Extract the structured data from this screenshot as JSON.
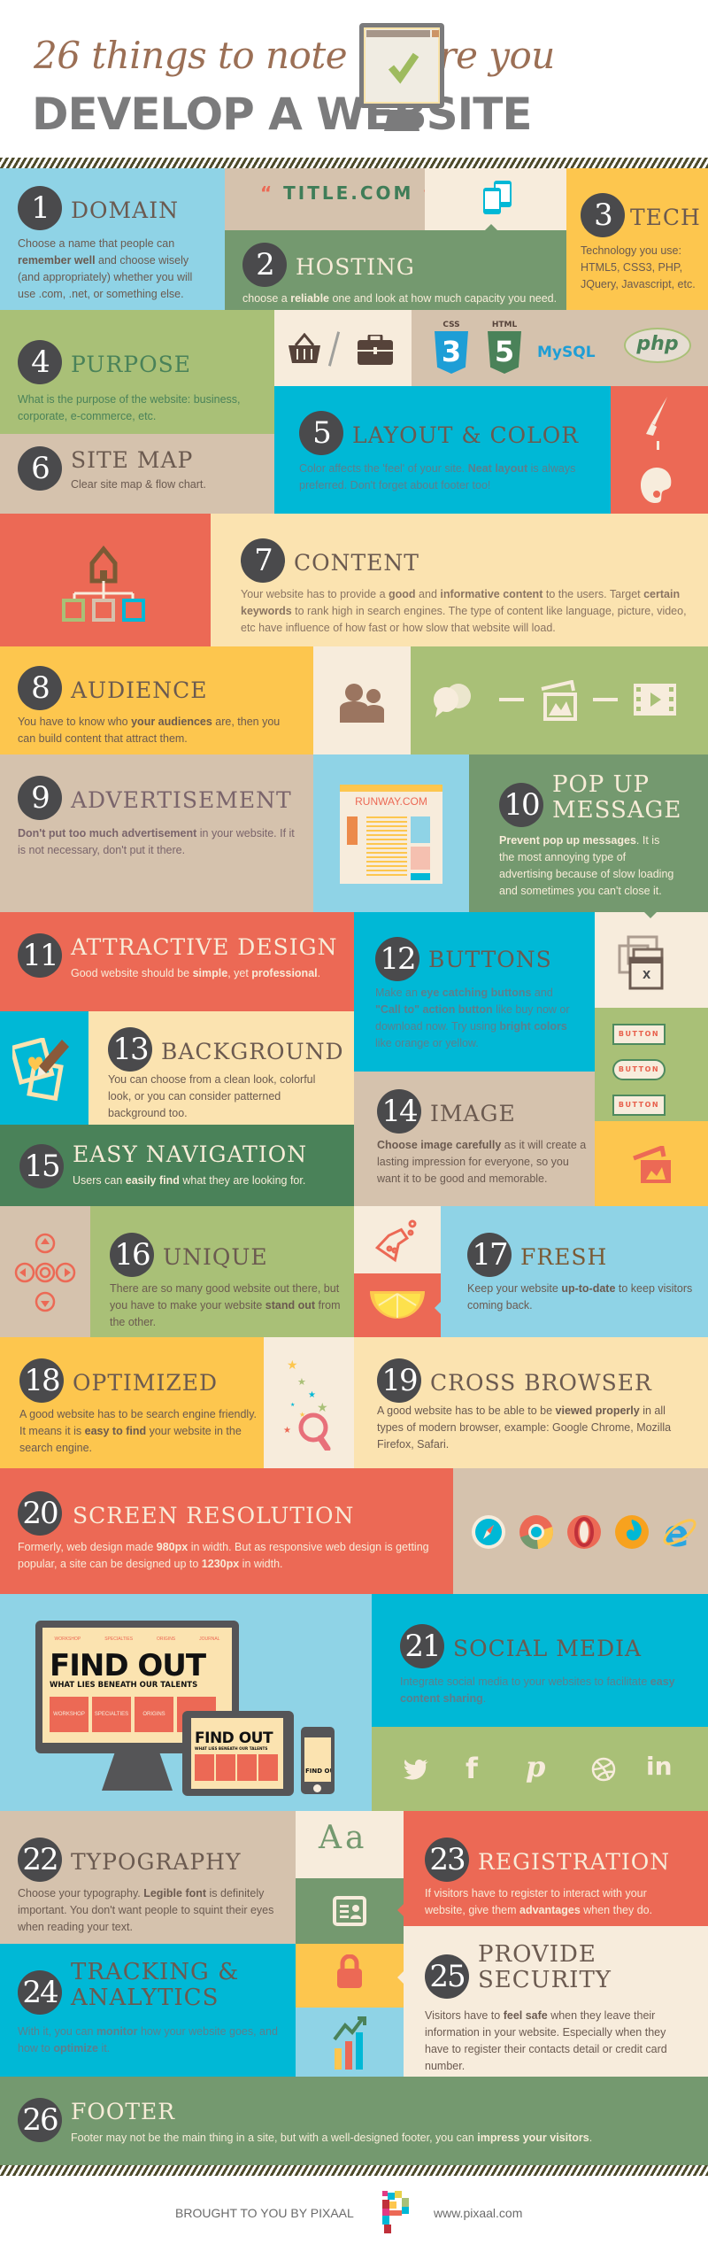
{
  "header": {
    "script_title": "26 things to note before you",
    "main_title": "DEVELOP A WEBSITE"
  },
  "colors": {
    "sky": "#8fd3e6",
    "cyan": "#00b8d6",
    "sand": "#d5c2ad",
    "cream": "#f7ecdc",
    "sage": "#74996f",
    "green": "#4a8259",
    "olive": "#a9c077",
    "yellow": "#fdc64e",
    "butter": "#fbe3b0",
    "coral": "#ec6955",
    "dark": "#4a4a4c"
  },
  "items": [
    {
      "num": "1",
      "title": "DOMAIN",
      "desc": [
        "Choose a name that people can ",
        {
          "b": "remember well"
        },
        " and choose wisely (and appropriately) whether you will use .com, .net, or something else."
      ]
    },
    {
      "num": "2",
      "title": "HOSTING",
      "desc": [
        "choose a ",
        {
          "b": "reliable"
        },
        " one and look at how much capacity you need."
      ]
    },
    {
      "num": "3",
      "title": "TECH",
      "desc": [
        "Technology you use: HTML5, CSS3, PHP, JQuery, Javascript, etc."
      ]
    },
    {
      "num": "4",
      "title": "PURPOSE",
      "desc": [
        "What is the purpose of the website: business, corporate, e-commerce, etc."
      ]
    },
    {
      "num": "5",
      "title": "LAYOUT & COLOR",
      "desc": [
        "Color affects the 'feel' of your site. ",
        {
          "b": "Neat layout"
        },
        " is always preferred. Don't forget about footer too!"
      ]
    },
    {
      "num": "6",
      "title": "SITE MAP",
      "desc": [
        "Clear site map & flow chart."
      ]
    },
    {
      "num": "7",
      "title": "CONTENT",
      "desc": [
        "Your website has to provide a ",
        {
          "b": "good"
        },
        " and ",
        {
          "b": "informative content"
        },
        " to the users. Target ",
        {
          "b": "certain keywords"
        },
        " to rank high in search engines. The type of content like language, picture, video, etc have influence of how fast or how slow that website will load."
      ]
    },
    {
      "num": "8",
      "title": "AUDIENCE",
      "desc": [
        "You have to know who ",
        {
          "b": "your audiences"
        },
        " are, then you can build content that attract them."
      ]
    },
    {
      "num": "9",
      "title": "ADVERTISEMENT",
      "desc": [
        {
          "b": "Don't put too much advertisement"
        },
        " in your website. If it is not necessary, don't put it there."
      ]
    },
    {
      "num": "10",
      "title": "POP UP MESSAGE",
      "desc": [
        {
          "b": "Prevent pop up messages"
        },
        ". It is the most annoying type of advertising because of slow loading and sometimes you can't close it."
      ]
    },
    {
      "num": "11",
      "title": "ATTRACTIVE DESIGN",
      "desc": [
        "Good website should be ",
        {
          "b": "simple"
        },
        ", yet ",
        {
          "b": "professional"
        },
        "."
      ]
    },
    {
      "num": "12",
      "title": "BUTTONS",
      "desc": [
        "Make an ",
        {
          "b": "eye catching buttons"
        },
        " and ",
        {
          "b": "\"Call to\" action button"
        },
        " like buy now or download now. Try using ",
        {
          "b": "bright colors"
        },
        " like orange or yellow."
      ]
    },
    {
      "num": "13",
      "title": "BACKGROUND",
      "desc": [
        "You can choose from a clean look, colorful look, or you can consider patterned background too."
      ]
    },
    {
      "num": "14",
      "title": "IMAGE",
      "desc": [
        {
          "b": "Choose image carefully"
        },
        " as it will create a lasting impression for everyone, so you want it to be good and memorable."
      ]
    },
    {
      "num": "15",
      "title": "EASY NAVIGATION",
      "desc": [
        "Users can ",
        {
          "b": "easily find"
        },
        " what they are looking for."
      ]
    },
    {
      "num": "16",
      "title": "UNIQUE",
      "desc": [
        "There are so many good website out there, but you have to make your website ",
        {
          "b": "stand out"
        },
        " from the other."
      ]
    },
    {
      "num": "17",
      "title": "FRESH",
      "desc": [
        "Keep your website ",
        {
          "b": "up-to-date"
        },
        " to keep visitors coming back."
      ]
    },
    {
      "num": "18",
      "title": "OPTIMIZED",
      "desc": [
        "A good website has to be search engine friendly. It means it is ",
        {
          "b": "easy to find"
        },
        " your website in the search engine."
      ]
    },
    {
      "num": "19",
      "title": "CROSS BROWSER",
      "desc": [
        "A good website has to be able to be ",
        {
          "b": "viewed properly"
        },
        " in all types of modern browser, example: Google Chrome, Mozilla Firefox, Safari."
      ]
    },
    {
      "num": "20",
      "title": "SCREEN RESOLUTION",
      "desc": [
        "Formerly, web design made ",
        {
          "b": "980px"
        },
        " in width. But as responsive web design is getting popular, a site can be designed up to ",
        {
          "b": "1230px"
        },
        " in width."
      ]
    },
    {
      "num": "21",
      "title": "SOCIAL MEDIA",
      "desc": [
        "Integrate social media to your websites to facilitate ",
        {
          "b": "easy content sharing"
        },
        "."
      ]
    },
    {
      "num": "22",
      "title": "TYPOGRAPHY",
      "desc": [
        "Choose your typography. ",
        {
          "b": "Legible font"
        },
        " is definitely important. You don't want people to squint their eyes when reading your text."
      ]
    },
    {
      "num": "23",
      "title": "REGISTRATION",
      "desc": [
        "If visitors have to register to interact with your website, give them ",
        {
          "b": "advantages"
        },
        " when they do."
      ]
    },
    {
      "num": "24",
      "title": "TRACKING & ANALYTICS",
      "desc": [
        "With it, you can ",
        {
          "b": "monitor"
        },
        " how your website goes, and how to ",
        {
          "b": "optimize"
        },
        " it."
      ]
    },
    {
      "num": "25",
      "title": "PROVIDE SECURITY",
      "desc": [
        "Visitors have to ",
        {
          "b": "feel safe"
        },
        " when they leave their information in your website. Especially when they have to register their contacts detail or credit card number."
      ]
    },
    {
      "num": "26",
      "title": "FOOTER",
      "desc": [
        "Footer may not be the main thing in a site, but with a well-designed footer, you can ",
        {
          "b": "impress your visitors"
        },
        "."
      ]
    }
  ],
  "visuals": {
    "domain_sample": "TITLE.COM",
    "tech_logos": [
      "CSS 3",
      "HTML 5",
      "MySQL",
      "php"
    ],
    "css_label": "CSS",
    "css_num": "3",
    "html_label": "HTML",
    "html_num": "5",
    "mysql_label": "MySQL",
    "php_label": "php",
    "ad_site": "RUNWAY.COM",
    "button_label": "BUTTON",
    "popup_close": "X",
    "typo_sample": "Aa",
    "find_out": "FIND OUT",
    "find_out_sub": "WHAT LIES BENEATH OUR TALENTS",
    "device_nav": [
      "WORKSHOP",
      "SPECIALTIES",
      "ORIGINS",
      "JOURNAL"
    ],
    "browsers": [
      "safari",
      "chrome",
      "opera",
      "firefox",
      "internet-explorer"
    ],
    "social": [
      "twitter",
      "facebook",
      "pinterest",
      "dribbble",
      "linkedin"
    ],
    "social_glyphs": {
      "facebook": "f",
      "pinterest": "p",
      "linkedin": "in"
    }
  },
  "footer": {
    "credit": "BROUGHT TO YOU BY PIXAAL",
    "url": "www.pixaal.com"
  }
}
